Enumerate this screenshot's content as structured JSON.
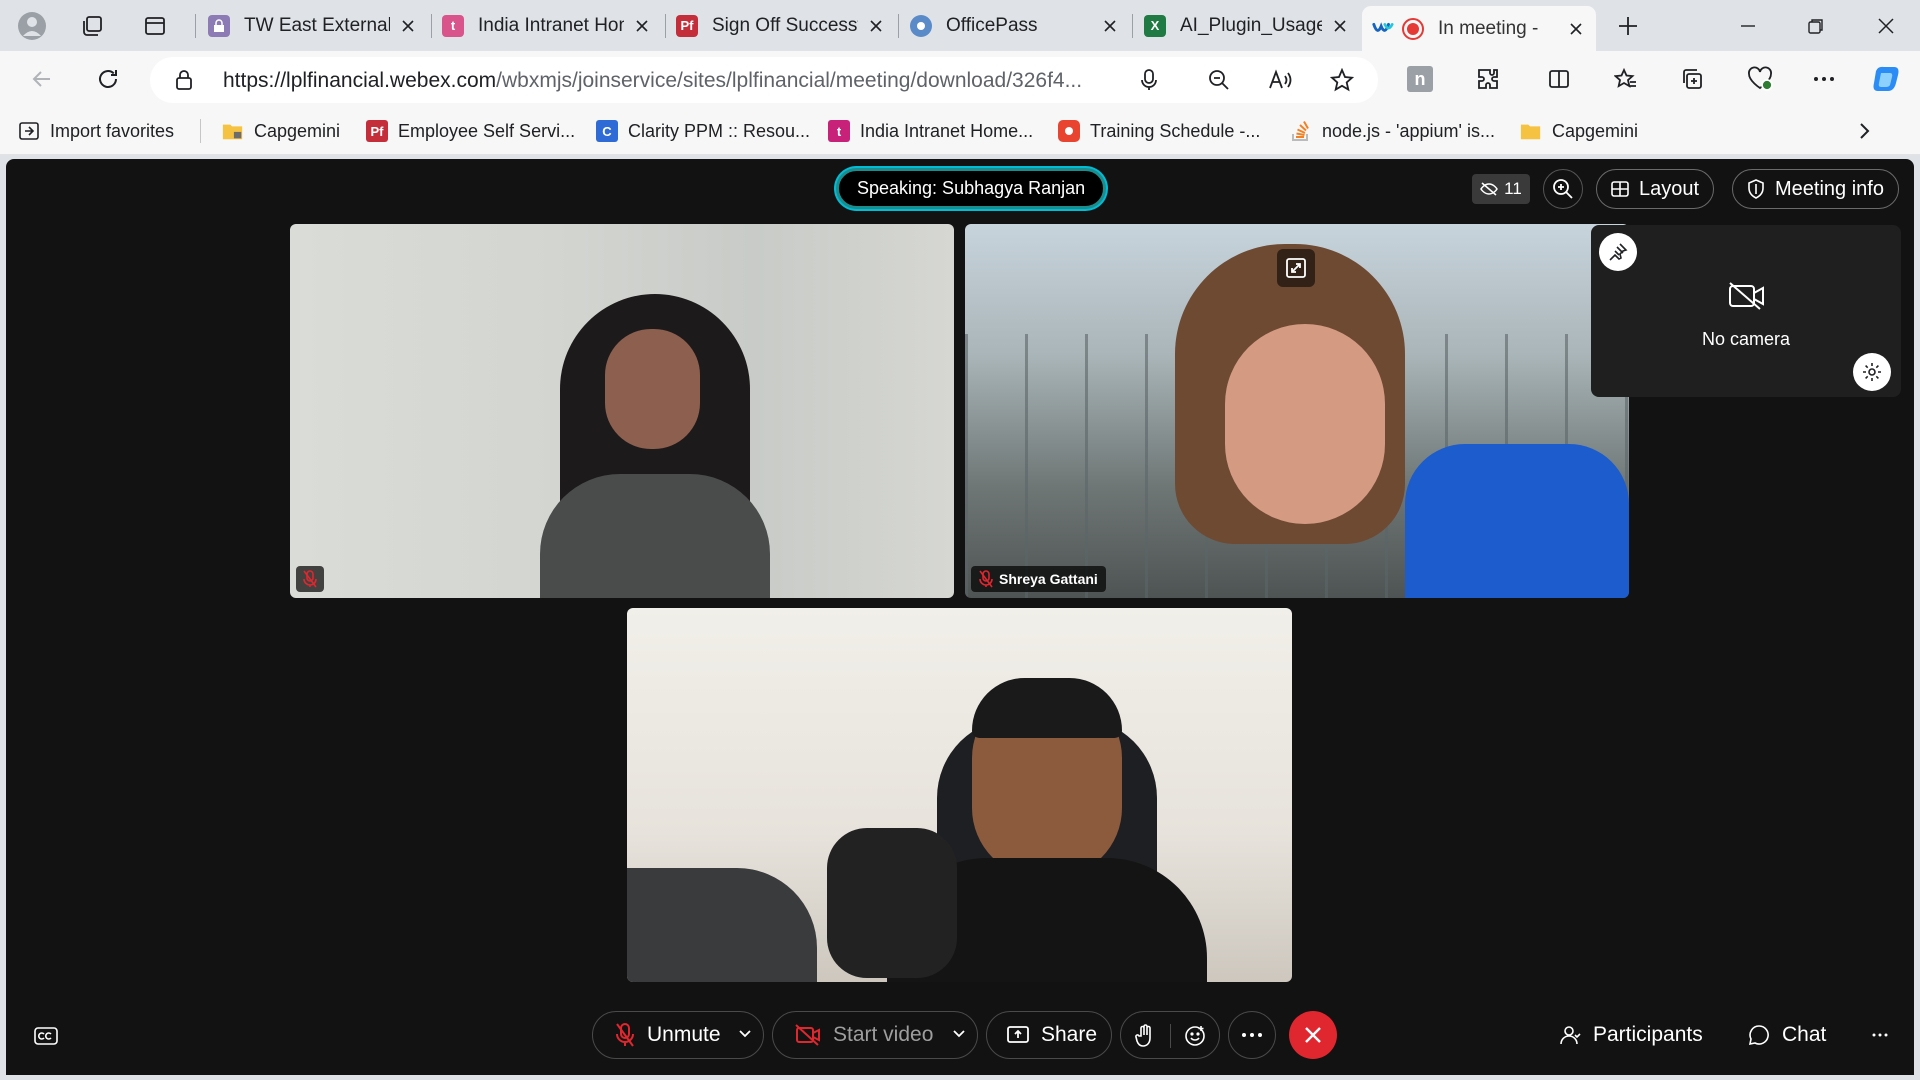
{
  "browser": {
    "tabs": [
      {
        "title": "TW East External",
        "favicon": "vpn-shield-icon",
        "color": "#8c7bb5"
      },
      {
        "title": "India Intranet Hom",
        "favicon": "intranet-t-icon",
        "color": "#d9548a"
      },
      {
        "title": "Sign Off Successfu",
        "favicon": "pf-icon",
        "color": "#c42e3b"
      },
      {
        "title": "OfficePass",
        "favicon": "officepass-icon",
        "color": "#5a8bc8"
      },
      {
        "title": "AI_Plugin_Usage_",
        "favicon": "excel-icon",
        "color": "#1f7a44"
      },
      {
        "title": "In meeting - ",
        "favicon": "recording-icon",
        "color": "#e53935"
      }
    ],
    "url_domain": "https://lplfinancial.webex.com",
    "url_path": "/wbxmjs/joinservice/sites/lplfinancial/meeting/download/326f4...",
    "favorites": [
      {
        "label": "Import favorites",
        "icon": "import-icon"
      },
      {
        "label": "Capgemini",
        "icon": "folder-lock-icon"
      },
      {
        "label": "Employee Self Servi...",
        "icon": "pf-icon"
      },
      {
        "label": "Clarity PPM :: Resou...",
        "icon": "clarity-icon"
      },
      {
        "label": "India Intranet Home...",
        "icon": "intranet-t-icon"
      },
      {
        "label": "Training Schedule -...",
        "icon": "training-icon"
      },
      {
        "label": "node.js - 'appium' is...",
        "icon": "stackoverflow-icon"
      },
      {
        "label": "Capgemini",
        "icon": "folder-icon"
      }
    ]
  },
  "meeting": {
    "speaking_label": "Speaking: Subhagya Ranjan",
    "hidden_count": "11",
    "layout_label": "Layout",
    "meeting_info_label": "Meeting info",
    "participants": [
      {
        "name": "",
        "muted": true
      },
      {
        "name": "Shreya Gattani",
        "muted": true
      },
      {
        "name": "",
        "muted": false
      }
    ],
    "self_view_label": "No camera",
    "controls": {
      "unmute": "Unmute",
      "start_video": "Start video",
      "share": "Share",
      "participants": "Participants",
      "chat": "Chat"
    },
    "colors": {
      "leave": "#e0262e",
      "speaking_border": "#00bcd4"
    }
  }
}
